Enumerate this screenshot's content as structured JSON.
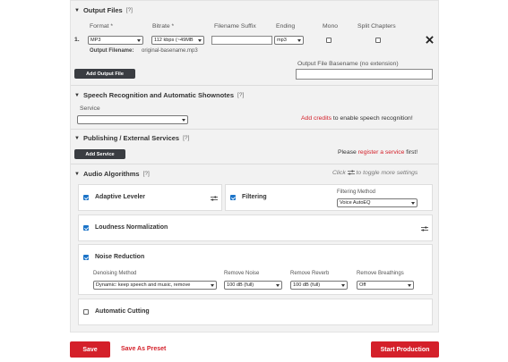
{
  "output_files": {
    "title": "Output Files",
    "help": "[?]",
    "col_format": "Format *",
    "col_bitrate": "Bitrate *",
    "col_suffix": "Filename Suffix",
    "col_ending": "Ending",
    "col_mono": "Mono",
    "col_split": "Split Chapters",
    "row_number": "1.",
    "format_value": "MP3",
    "bitrate_value": "112 kbps (~49MB",
    "suffix_value": "",
    "ending_value": "mp3",
    "mono_checked": false,
    "split_checked": false,
    "output_filename_label": "Output Filename:",
    "output_filename_value": "original-basename.mp3",
    "add_button": "Add Output File",
    "basename_label": "Output File Basename (no extension)",
    "basename_value": "",
    "remove_icon": "close-icon"
  },
  "speech": {
    "title": "Speech Recognition and Automatic Shownotes",
    "help": "[?]",
    "service_label": "Service",
    "service_value": "",
    "add_credits_link": "Add credits",
    "add_credits_suffix": " to enable speech recognition!"
  },
  "publishing": {
    "title": "Publishing / External Services",
    "help": "[?]",
    "add_button": "Add Service",
    "register_prefix": "Please ",
    "register_link": "register a service",
    "register_suffix": " first!"
  },
  "audio": {
    "title": "Audio Algorithms",
    "help": "[?]",
    "hint_prefix": "Click ",
    "hint_suffix": " to toggle more settings",
    "adaptive_leveler": "Adaptive Leveler",
    "filtering": "Filtering",
    "filtering_method_label": "Filtering Method",
    "filtering_method_value": "Voice AutoEQ",
    "loudness": "Loudness Normalization",
    "noise_reduction": "Noise Reduction",
    "denoising_label": "Denoising Method",
    "denoising_value": "Dynamic: keep speech and music, remove",
    "remove_noise_label": "Remove Noise",
    "remove_noise_value": "100 dB (full)",
    "remove_reverb_label": "Remove Reverb",
    "remove_reverb_value": "100 dB (full)",
    "remove_breathings_label": "Remove Breathings",
    "remove_breathings_value": "Off",
    "automatic_cutting": "Automatic Cutting",
    "adaptive_checked": true,
    "filtering_checked": true,
    "loudness_checked": true,
    "noise_checked": true,
    "cutting_checked": false
  },
  "footer": {
    "save": "Save",
    "save_as_preset": "Save As Preset",
    "start_production": "Start Production"
  },
  "colors": {
    "accent_red": "#d4202a",
    "checkbox_blue": "#1a73c8",
    "dark_button": "#3a3d42"
  }
}
